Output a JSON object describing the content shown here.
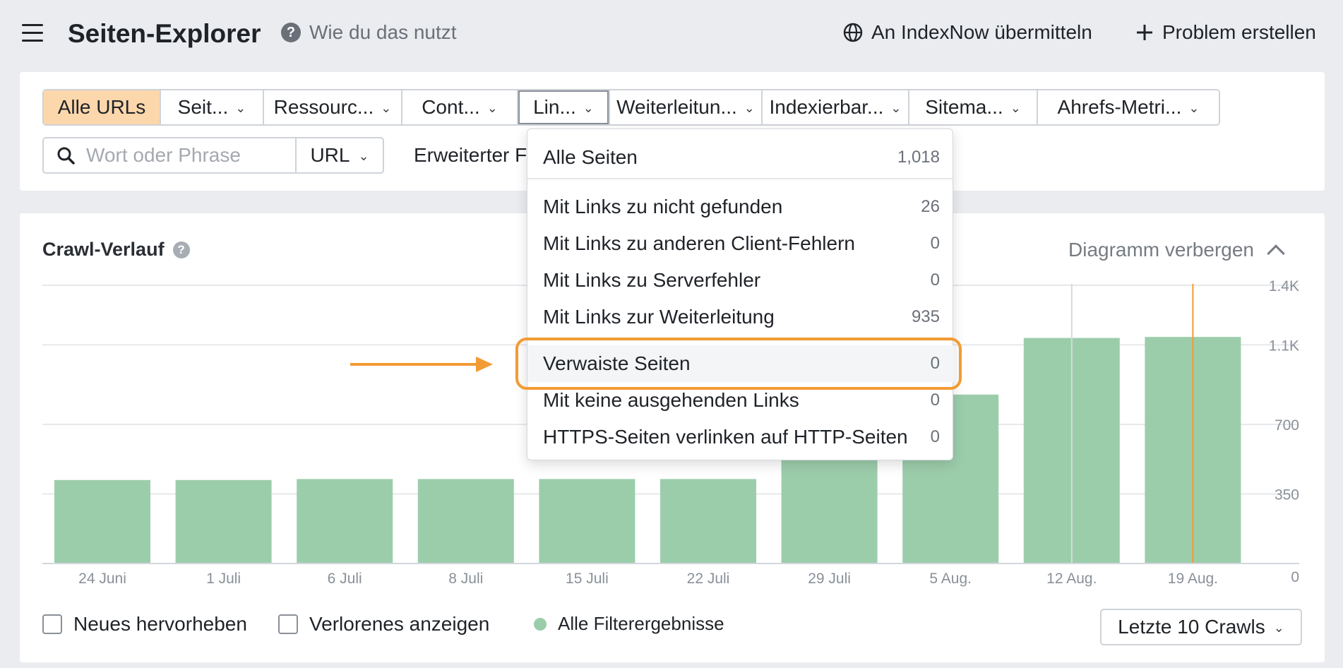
{
  "header": {
    "title": "Seiten-Explorer",
    "help_label": "Wie du das nutzt",
    "indexnow_label": "An IndexNow übermitteln",
    "problem_label": "Problem erstellen"
  },
  "filters": {
    "tabs": [
      {
        "label": "Alle URLs"
      },
      {
        "label": "Seit..."
      },
      {
        "label": "Ressourc..."
      },
      {
        "label": "Cont..."
      },
      {
        "label": "Lin..."
      },
      {
        "label": "Weiterleitun..."
      },
      {
        "label": "Indexierbar..."
      },
      {
        "label": "Sitema..."
      },
      {
        "label": "Ahrefs-Metri..."
      }
    ],
    "search_placeholder": "Wort oder Phrase",
    "url_select": "URL",
    "advanced_label": "Erweiterter Filter"
  },
  "dropdown": {
    "items": [
      {
        "label": "Alle Seiten",
        "count": "1,018"
      },
      {
        "label": "Mit Links zu nicht gefunden",
        "count": "26"
      },
      {
        "label": "Mit Links zu anderen Client-Fehlern",
        "count": "0"
      },
      {
        "label": "Mit Links zu Serverfehler",
        "count": "0"
      },
      {
        "label": "Mit Links zur Weiterleitung",
        "count": "935"
      },
      {
        "label": "Verwaiste Seiten",
        "count": "0"
      },
      {
        "label": "Mit keine ausgehenden Links",
        "count": "0"
      },
      {
        "label": "HTTPS-Seiten verlinken auf HTTP-Seiten",
        "count": "0"
      }
    ],
    "highlighted_index": 5
  },
  "chart_panel": {
    "title": "Crawl-Verlauf",
    "hide_label": "Diagramm verbergen",
    "legend_new": "Neues hervorheben",
    "legend_lost": "Verlorenes anzeigen",
    "legend_all": "Alle Filterergebnisse",
    "range_select": "Letzte 10 Crawls"
  },
  "chart_data": {
    "type": "bar",
    "categories": [
      "24 Juni",
      "1 Juli",
      "6 Juli",
      "8 Juli",
      "15 Juli",
      "22 Juli",
      "29 Juli",
      "5 Aug.",
      "12 Aug.",
      "19 Aug."
    ],
    "values": [
      420,
      420,
      425,
      425,
      425,
      425,
      620,
      850,
      1135,
      1140
    ],
    "ylim": [
      0,
      1400
    ],
    "yticks": [
      0,
      350,
      700,
      1100,
      1400
    ],
    "ytick_labels": [
      "0",
      "350",
      "700",
      "1.1K",
      "1.4K"
    ],
    "title": "",
    "xlabel": "",
    "ylabel": "",
    "bar_color": "#9ccdab",
    "marker_color": "#f29b34",
    "grid": true
  },
  "colors": {
    "active_tab": "#fbd7ab",
    "accent_orange": "#f29b34",
    "bar_green": "#9ccdab"
  }
}
